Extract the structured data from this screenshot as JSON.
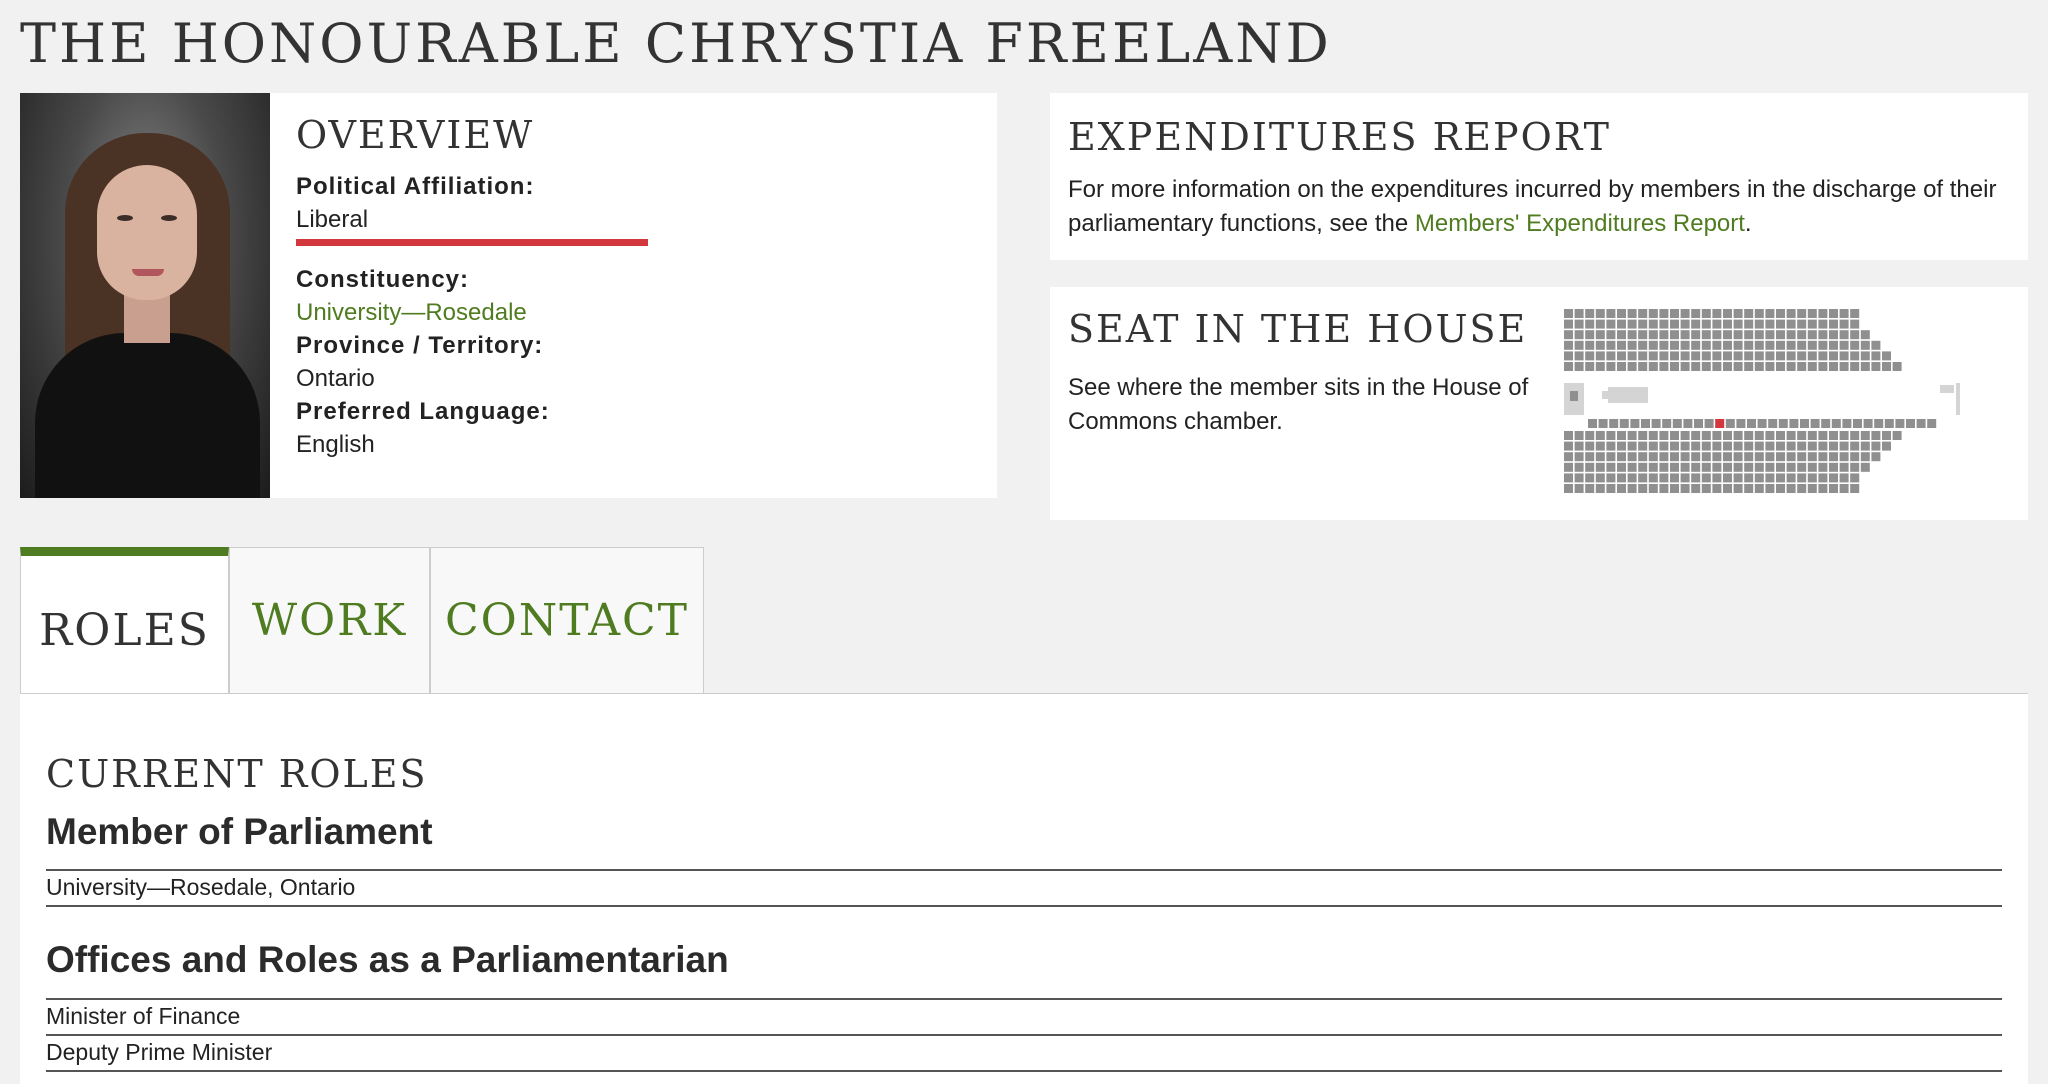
{
  "page": {
    "title": "THE HONOURABLE CHRYSTIA FREELAND"
  },
  "overview": {
    "heading": "OVERVIEW",
    "fields": [
      {
        "label": "Political Affiliation:",
        "value": "Liberal"
      },
      {
        "label": "Constituency:",
        "value": "University—Rosedale"
      },
      {
        "label": "Province / Territory:",
        "value": "Ontario"
      },
      {
        "label": "Preferred Language:",
        "value": "English"
      }
    ],
    "party_color": "#d2373d"
  },
  "expenditures": {
    "heading": "EXPENDITURES REPORT",
    "text": "For more information on the expenditures incurred by members in the discharge of their parliamentary functions, see the ",
    "link": "Members' Expenditures Report",
    "end": "."
  },
  "seat": {
    "heading": "SEAT IN THE HOUSE",
    "text": "See where the member sits in the House of Commons chamber.",
    "highlight_color": "#d2373d"
  },
  "tabs": [
    {
      "label": "ROLES",
      "active": true
    },
    {
      "label": "WORK",
      "active": false
    },
    {
      "label": "CONTACT",
      "active": false
    }
  ],
  "roles": {
    "heading": "CURRENT ROLES",
    "mp_heading": "Member of Parliament",
    "mp_items": [
      "University—Rosedale, Ontario"
    ],
    "offices_heading": "Offices and Roles as a Parliamentarian",
    "offices_items": [
      "Minister of Finance",
      "Deputy Prime Minister"
    ]
  },
  "colors": {
    "accent": "#4f7c20",
    "party": "#d2373d"
  }
}
